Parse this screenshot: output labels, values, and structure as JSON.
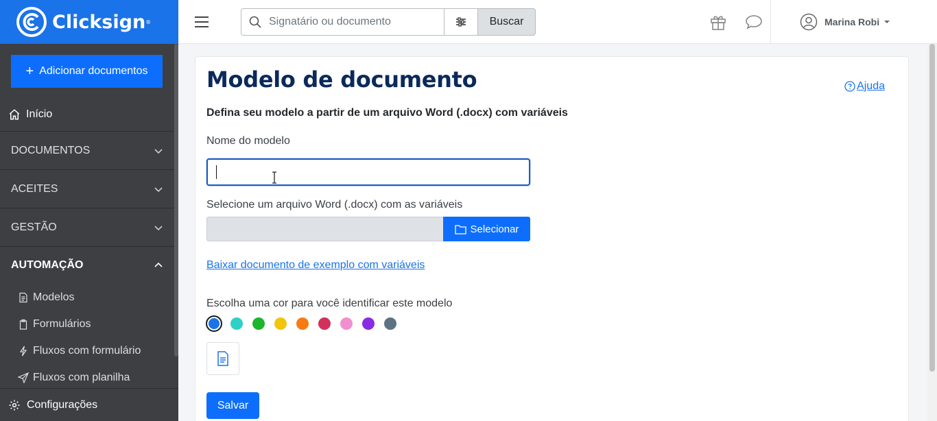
{
  "app": {
    "brand": "Clicksign",
    "brand_reg": "®",
    "accent": "#1a73e8"
  },
  "sidebar": {
    "add_button": "Adicionar documentos",
    "home": "Início",
    "sections": [
      {
        "label": "DOCUMENTOS",
        "expanded": false
      },
      {
        "label": "ACEITES",
        "expanded": false
      },
      {
        "label": "GESTÃO",
        "expanded": false
      },
      {
        "label": "AUTOMAÇÃO",
        "expanded": true
      }
    ],
    "automation_items": [
      "Modelos",
      "Formulários",
      "Fluxos com formulário",
      "Fluxos com planilha"
    ],
    "settings": "Configurações"
  },
  "topbar": {
    "search_placeholder": "Signatário ou documento",
    "search_button": "Buscar",
    "user_name": "Marina Robi"
  },
  "main": {
    "title": "Modelo de documento",
    "help": "Ajuda",
    "subtitle": "Defina seu modelo a partir de um arquivo Word (.docx) com variáveis",
    "name_label": "Nome do modelo",
    "name_value": "",
    "file_label": "Selecione um arquivo Word (.docx) com as variáveis",
    "select_button": "Selecionar",
    "example_link": "Baixar documento de exemplo com variáveis",
    "color_label": "Escolha uma cor para você identificar este modelo",
    "colors": [
      "#1a73e8",
      "#2ed1c6",
      "#1db52b",
      "#f2c40c",
      "#f57c12",
      "#d1315a",
      "#f28fd0",
      "#8a2be2",
      "#5b7385"
    ],
    "selected_color": "#1a73e8",
    "save_button": "Salvar"
  }
}
